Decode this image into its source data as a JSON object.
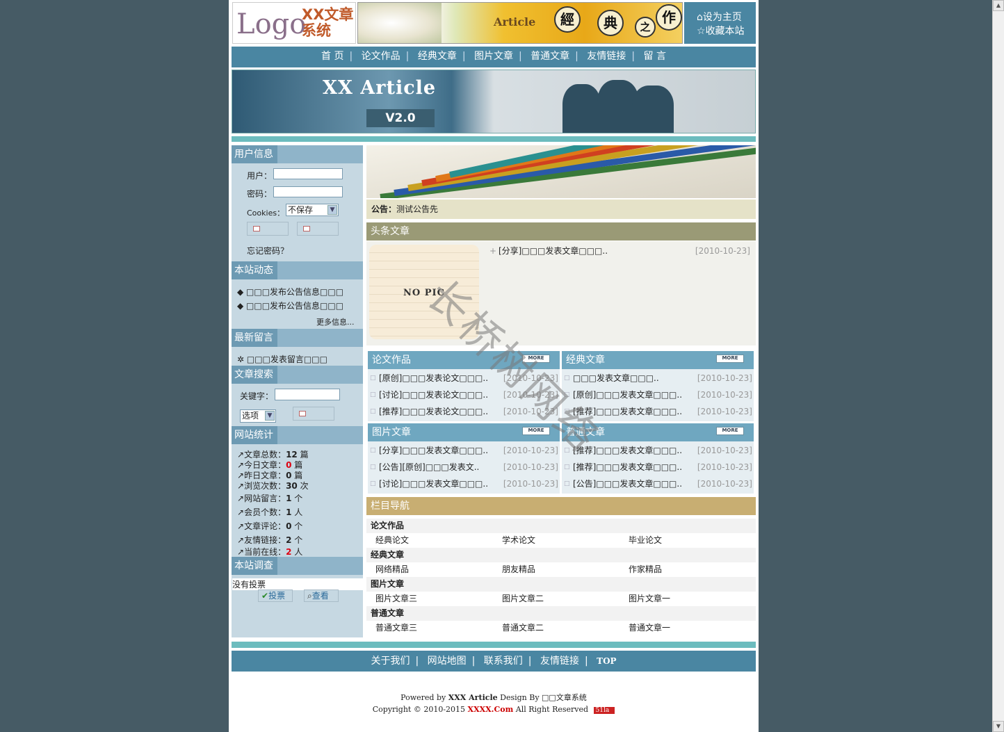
{
  "header": {
    "logo_word": "Logo",
    "logo_cn": "XX文章系统",
    "banner_text": "Article",
    "banner_seals": [
      "經",
      "典",
      "之",
      "作"
    ],
    "set_home": "设为主页",
    "bookmark": "收藏本站"
  },
  "nav": [
    "首 页",
    "论文作品",
    "经典文章",
    "图片文章",
    "普通文章",
    "友情链接",
    "留 言"
  ],
  "hero": {
    "title": "XX Article",
    "version": "V2.0"
  },
  "sidebar": {
    "user_info": {
      "title": "用户信息",
      "user_label": "用户：",
      "pass_label": "密码：",
      "cookies_label": "Cookies：",
      "cookies_value": "不保存",
      "forgot": "忘记密码？"
    },
    "news": {
      "title": "本站动态",
      "items": [
        "□□□发布公告信息□□□",
        "□□□发布公告信息□□□"
      ],
      "more": "更多信息..."
    },
    "messages": {
      "title": "最新留言",
      "items": [
        "□□□发表留言□□□"
      ]
    },
    "search": {
      "title": "文章搜索",
      "keyword_label": "关键字：",
      "option": "选项"
    },
    "stats": {
      "title": "网站统计",
      "lines": [
        {
          "label": "文章总数：",
          "value": "12",
          "unit": "篇"
        },
        {
          "label": "今日文章：",
          "value": "0",
          "unit": "篇"
        },
        {
          "label": "昨日文章：",
          "value": "0",
          "unit": "篇"
        },
        {
          "label": "浏览次数：",
          "value": "30",
          "unit": "次"
        },
        {
          "label": "网站留言：",
          "value": "1",
          "unit": "个"
        },
        {
          "label": "会员个数：",
          "value": "1",
          "unit": "人"
        },
        {
          "label": "文章评论：",
          "value": "0",
          "unit": "个"
        },
        {
          "label": "友情链接：",
          "value": "2",
          "unit": "个"
        },
        {
          "label": "当前在线：",
          "value": "2",
          "unit": "人"
        }
      ]
    },
    "poll": {
      "title": "本站调查",
      "none": "没有投票",
      "vote": "投票",
      "view": "查看"
    }
  },
  "main": {
    "notice_label": "公告：",
    "notice_text": "测试公告先",
    "headline": {
      "title": "头条文章",
      "nopic": "NO PIC",
      "items": [
        {
          "title": "[分享]□□□发表文章□□□..",
          "date": "[2010-10-23]"
        }
      ]
    },
    "more_label": "MORE",
    "panels": [
      {
        "title": "论文作品",
        "rows": [
          {
            "title": "[原创]□□□发表论文□□□..",
            "date": "[2010-10-23]"
          },
          {
            "title": "[讨论]□□□发表论文□□□..",
            "date": "[2010-10-23]"
          },
          {
            "title": "[推荐]□□□发表论文□□□..",
            "date": "[2010-10-23]"
          }
        ]
      },
      {
        "title": "经典文章",
        "rows": [
          {
            "title": "□□□发表文章□□□..",
            "date": "[2010-10-23]"
          },
          {
            "title": "[原创]□□□发表文章□□□..",
            "date": "[2010-10-23]"
          },
          {
            "title": "[推荐]□□□发表文章□□□..",
            "date": "[2010-10-23]"
          }
        ]
      },
      {
        "title": "图片文章",
        "rows": [
          {
            "title": "[分享]□□□发表文章□□□..",
            "date": "[2010-10-23]"
          },
          {
            "title": "[公告][原创]□□□发表文..",
            "date": "[2010-10-23]"
          },
          {
            "title": "[讨论]□□□发表文章□□□..",
            "date": "[2010-10-23]"
          }
        ]
      },
      {
        "title": "普通文章",
        "rows": [
          {
            "title": "[推荐]□□□发表文章□□□..",
            "date": "[2010-10-23]"
          },
          {
            "title": "[推荐]□□□发表文章□□□..",
            "date": "[2010-10-23]"
          },
          {
            "title": "[公告]□□□发表文章□□□..",
            "date": "[2010-10-23]"
          }
        ]
      }
    ],
    "catnav": {
      "title": "栏目导航",
      "groups": [
        {
          "name": "论文作品",
          "items": [
            "经典论文",
            "学术论文",
            "毕业论文"
          ]
        },
        {
          "name": "经典文章",
          "items": [
            "网络精品",
            "朋友精品",
            "作家精品"
          ]
        },
        {
          "name": "图片文章",
          "items": [
            "图片文章三",
            "图片文章二",
            "图片文章一"
          ]
        },
        {
          "name": "普通文章",
          "items": [
            "普通文章三",
            "普通文章二",
            "普通文章一"
          ]
        }
      ]
    }
  },
  "footer": {
    "links": [
      "关于我们",
      "网站地图",
      "联系我们",
      "友情链接",
      "TOP"
    ],
    "powered_pre": "Powered by ",
    "powered_brand": "XXX Article",
    "powered_post": " Design By □□文章系统",
    "copyright_pre": "Copyright © 2010-2015 ",
    "copyright_brand": "XXXX.Com",
    "copyright_post": " All Right Reserved",
    "badge": "51la"
  },
  "watermark": "长桥树网络",
  "colors": {
    "background": "#465b65",
    "nav_blue": "#4a86a2",
    "teal_bar": "#6cbcbe",
    "sidebar_bg": "#c6d8e2",
    "headline_bar": "#9a9a76",
    "catnav_bar": "#c8ae72",
    "highlight_red": "#d01111"
  }
}
